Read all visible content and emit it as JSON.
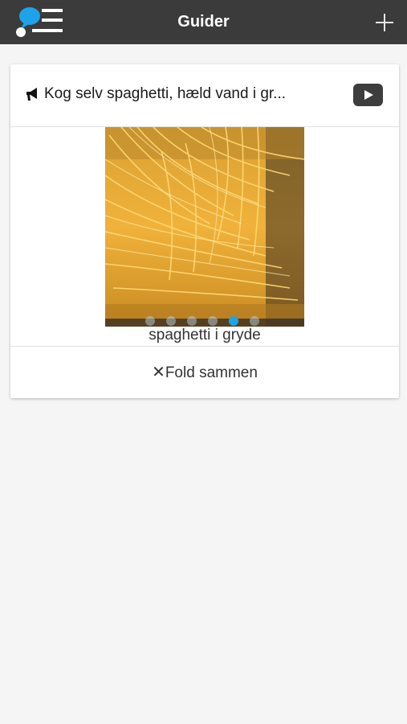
{
  "header": {
    "title": "Guider",
    "logo_icon": "chat-bubble-list-logo",
    "add_icon": "plus-icon",
    "background_color": "#3b3b3b"
  },
  "card": {
    "title": "Kog selv spaghetti, hæld vand i gr...",
    "title_icon": "megaphone-icon",
    "video_icon": "youtube-play-icon",
    "media": {
      "image_icon": "spaghetti-photo",
      "slide_count": 6,
      "active_slide": 5,
      "active_dot_color": "#1ea3ea"
    },
    "caption": "spaghetti i gryde",
    "collapse_label": "Fold sammen",
    "collapse_icon": "close-icon"
  }
}
